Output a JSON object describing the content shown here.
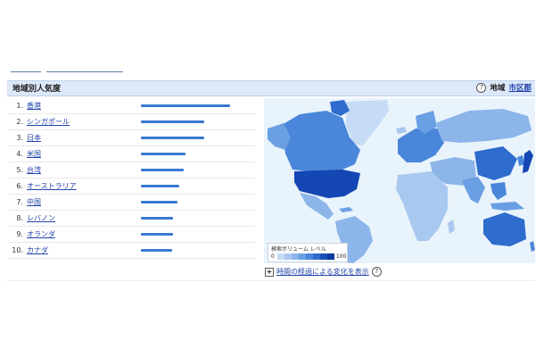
{
  "header": {
    "title": "地域別人気度",
    "region_label": "地域",
    "city_link": "市区郡"
  },
  "rankings": [
    {
      "rank": "1.",
      "name": "香港",
      "value": 100
    },
    {
      "rank": "2.",
      "name": "シンガポール",
      "value": 71
    },
    {
      "rank": "3.",
      "name": "日本",
      "value": 71
    },
    {
      "rank": "4.",
      "name": "米国",
      "value": 50
    },
    {
      "rank": "5.",
      "name": "台湾",
      "value": 48
    },
    {
      "rank": "6.",
      "name": "オーストラリア",
      "value": 43
    },
    {
      "rank": "7.",
      "name": "中国",
      "value": 41
    },
    {
      "rank": "8.",
      "name": "レバノン",
      "value": 36
    },
    {
      "rank": "9.",
      "name": "オランダ",
      "value": 36
    },
    {
      "rank": "10.",
      "name": "カナダ",
      "value": 35
    }
  ],
  "legend": {
    "title": "検索ボリューム レベル",
    "min": "0",
    "max": "100",
    "colors": [
      "#c6dbf5",
      "#a9c8f0",
      "#8cb5ea",
      "#6a9fe3",
      "#4a86d9",
      "#2e6ccd",
      "#1850b8",
      "#0b3a9c"
    ]
  },
  "map_colors": {
    "ocean": "#e9f3fb",
    "low": "#c6dbf5",
    "mid": "#8cb5ea",
    "high": "#4a86d9",
    "top": "#1446b4"
  },
  "footer": {
    "change_link": "時間の経過による変化を表示"
  }
}
